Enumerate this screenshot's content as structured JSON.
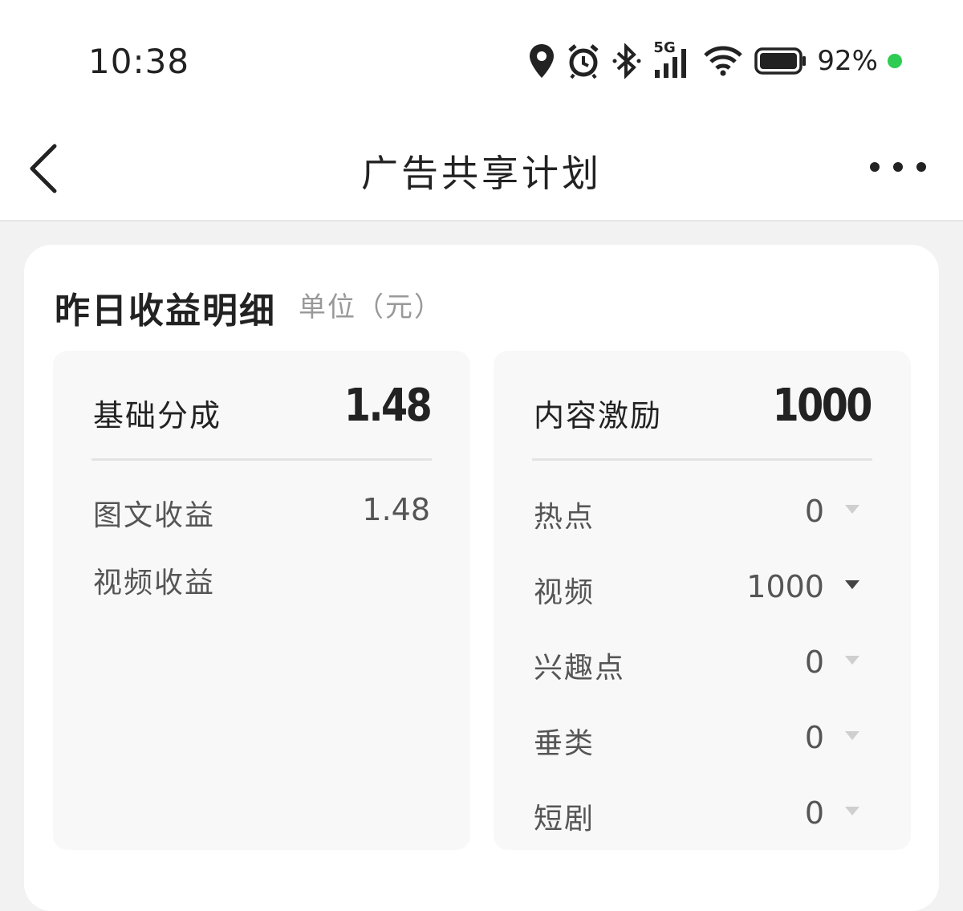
{
  "status_bar": {
    "time": "10:38",
    "network": "5G",
    "battery_percent": "92%",
    "icons": [
      "location-icon",
      "alarm-icon",
      "bluetooth-icon",
      "signal-icon",
      "wifi-icon",
      "battery-icon"
    ],
    "dot_color": "#2ecc52"
  },
  "nav": {
    "title": "广告共享计划"
  },
  "card": {
    "title": "昨日收益明细",
    "unit": "单位（元）"
  },
  "basic_share": {
    "label": "基础分成",
    "value": "1.48",
    "rows": [
      {
        "label": "图文收益",
        "value": "1.48"
      },
      {
        "label": "视频收益",
        "value": ""
      }
    ]
  },
  "content_incentive": {
    "label": "内容激励",
    "value": "1000",
    "rows": [
      {
        "label": "热点",
        "value": "0",
        "expanded": false
      },
      {
        "label": "视频",
        "value": "1000",
        "expanded": false,
        "highlight": true
      },
      {
        "label": "兴趣点",
        "value": "0",
        "expanded": false
      },
      {
        "label": "垂类",
        "value": "0",
        "expanded": false
      },
      {
        "label": "短剧",
        "value": "0",
        "expanded": false
      }
    ]
  }
}
